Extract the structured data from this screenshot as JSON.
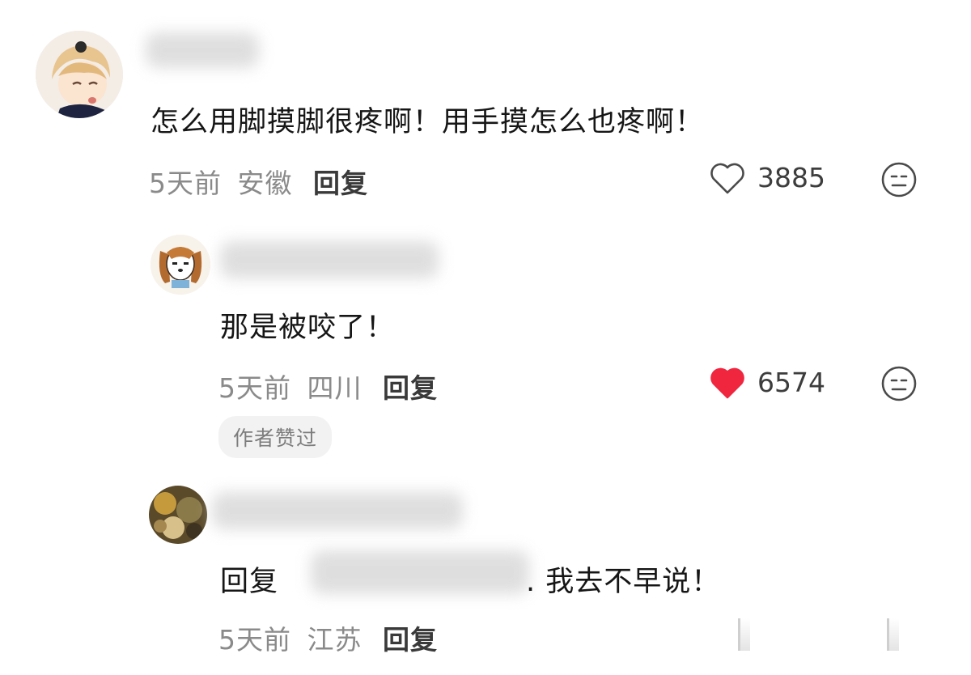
{
  "comments": [
    {
      "text": "怎么用脚摸脚很疼啊！用手摸怎么也疼啊！",
      "time": "5天前",
      "location": "安徽",
      "reply_label": "回复",
      "likes": "3885",
      "liked": false
    },
    {
      "text": "那是被咬了！",
      "time": "5天前",
      "location": "四川",
      "reply_label": "回复",
      "likes": "6574",
      "liked": true,
      "badge": "作者赞过"
    },
    {
      "reply_prefix": "回复",
      "text": ". 我去不早说！",
      "time": "5天前",
      "location": "江苏",
      "reply_label": "回复"
    }
  ],
  "colors": {
    "like_active": "#f0263f",
    "meta_gray": "#8a8a8a"
  },
  "icons": [
    "avatar-anime-boy",
    "avatar-dog",
    "avatar-photo",
    "heart-outline-icon",
    "heart-filled-icon",
    "neutral-face-icon"
  ]
}
